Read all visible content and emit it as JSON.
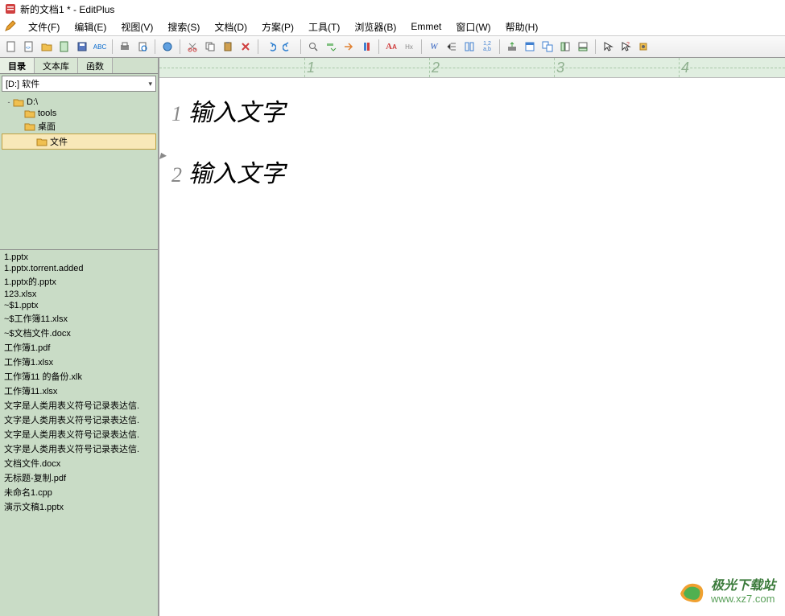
{
  "window": {
    "title": "新的文档1 * - EditPlus"
  },
  "menus": {
    "file": "文件(F)",
    "edit": "编辑(E)",
    "view": "视图(V)",
    "search": "搜索(S)",
    "doc": "文档(D)",
    "project": "方案(P)",
    "tool": "工具(T)",
    "browser": "浏览器(B)",
    "emmet": "Emmet",
    "window": "窗口(W)",
    "help": "帮助(H)"
  },
  "sidebar": {
    "tabs": {
      "dir": "目录",
      "lib": "文本库",
      "func": "函数"
    },
    "path": "[D:]  软件",
    "tree": [
      {
        "indent": 0,
        "label": "D:\\",
        "expand": "-"
      },
      {
        "indent": 1,
        "label": "tools",
        "expand": ""
      },
      {
        "indent": 1,
        "label": "桌面",
        "expand": ""
      },
      {
        "indent": 2,
        "label": "文件",
        "expand": ""
      }
    ],
    "files": [
      "1.pptx",
      "1.pptx.torrent.added",
      "1.pptx的.pptx",
      "123.xlsx",
      "~$1.pptx",
      "~$工作簿11.xlsx",
      "~$文档文件.docx",
      "工作簿1.pdf",
      "工作簿1.xlsx",
      "工作簿11 的备份.xlk",
      "工作簿11.xlsx",
      "文字是人类用表义符号记录表达信.",
      "文字是人类用表义符号记录表达信.",
      "文字是人类用表义符号记录表达信.",
      "文字是人类用表义符号记录表达信.",
      "文档文件.docx",
      "无标题-复制.pdf",
      "未命名1.cpp",
      "演示文稿1.pptx"
    ]
  },
  "editor": {
    "ruler": [
      "1",
      "2",
      "3",
      "4"
    ],
    "lines": [
      {
        "num": "1",
        "text": "输入文字"
      },
      {
        "num": "2",
        "text": "输入文字"
      }
    ]
  },
  "watermark": {
    "cn": "极光下载站",
    "url": "www.xz7.com"
  }
}
